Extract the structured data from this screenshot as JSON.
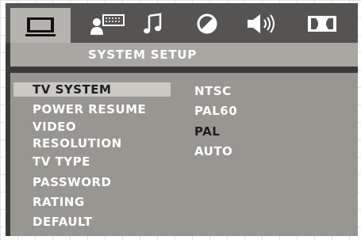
{
  "icon_tabs": [
    {
      "name": "system",
      "icon": "monitor-icon",
      "active": true
    },
    {
      "name": "language",
      "icon": "person-keyboard-icon",
      "active": false
    },
    {
      "name": "audio",
      "icon": "music-note-icon",
      "active": false
    },
    {
      "name": "video",
      "icon": "video-circle-icon",
      "active": false
    },
    {
      "name": "speaker",
      "icon": "speaker-icon",
      "active": false
    },
    {
      "name": "dolby",
      "icon": "dolby-icon",
      "active": false
    }
  ],
  "header": {
    "title": "SYSTEM SETUP"
  },
  "menu": {
    "items": [
      {
        "label": "TV SYSTEM",
        "selected": true
      },
      {
        "label": "POWER RESUME",
        "selected": false
      },
      {
        "label": "VIDEO",
        "selected": false
      },
      {
        "label": "RESOLUTION",
        "selected": false
      },
      {
        "label": "TV TYPE",
        "selected": false
      },
      {
        "label": "PASSWORD",
        "selected": false
      },
      {
        "label": "RATING",
        "selected": false
      },
      {
        "label": "DEFAULT",
        "selected": false
      }
    ]
  },
  "options": {
    "items": [
      {
        "label": "NTSC",
        "current": false
      },
      {
        "label": "PAL60",
        "current": false
      },
      {
        "label": "PAL",
        "current": true
      },
      {
        "label": "AUTO",
        "current": false
      }
    ]
  },
  "colors": {
    "screen_bg": "#3b3a38",
    "icon_bar_bg": "#555452",
    "title_bar_bg": "#a9a7a2",
    "content_bg": "#989690",
    "highlight_bg": "#cbc9c4",
    "text_light": "#ffffff",
    "text_dark": "#1e1e1e"
  }
}
